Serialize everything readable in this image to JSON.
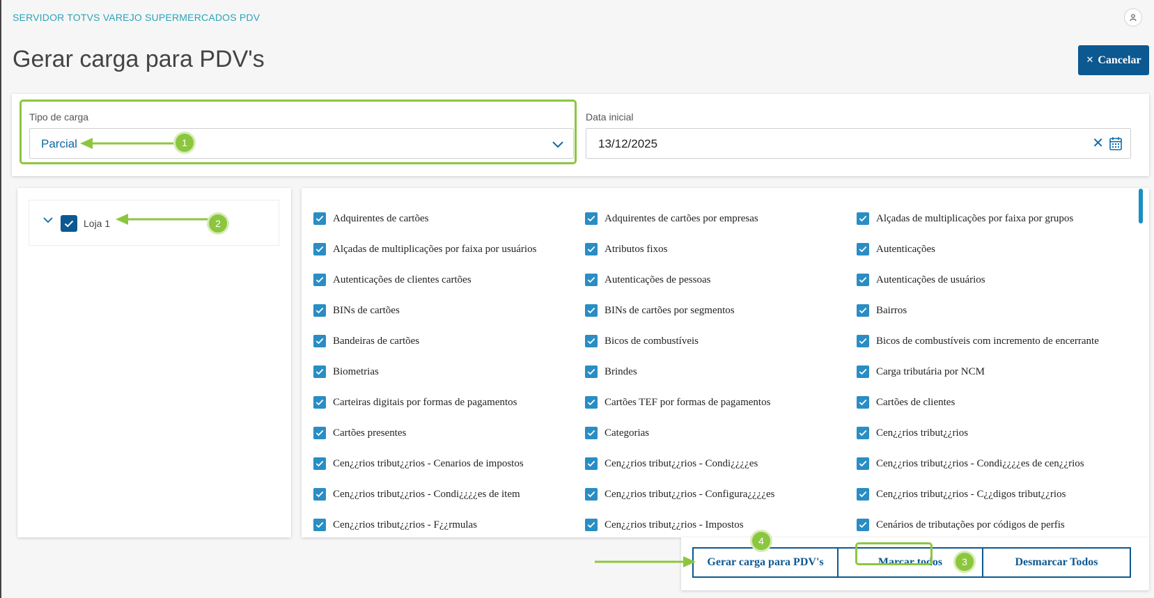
{
  "header": {
    "app_title": "SERVIDOR TOTVS VAREJO SUPERMERCADOS PDV",
    "page_title": "Gerar carga para PDV's",
    "cancel_label": "Cancelar",
    "user_icon": "user-icon"
  },
  "filters": {
    "tipo_label": "Tipo de carga",
    "tipo_value": "Parcial",
    "data_label": "Data inicial",
    "data_value": "13/12/2025"
  },
  "tree": {
    "node_label": "Loja 1",
    "checked": true
  },
  "items": [
    "Adquirentes de cartões",
    "Adquirentes de cartões por empresas",
    "Alçadas de multiplicações por faixa por grupos",
    "Alçadas de multiplicações por faixa por usuários",
    "Atributos fixos",
    "Autenticações",
    "Autenticações de clientes cartões",
    "Autenticações de pessoas",
    "Autenticações de usuários",
    "BINs de cartões",
    "BINs de cartões por segmentos",
    "Bairros",
    "Bandeiras de cartões",
    "Bicos de combustíveis",
    "Bicos de combustíveis com incremento de encerrante",
    "Biometrias",
    "Brindes",
    "Carga tributária por NCM",
    "Carteiras digitais por formas de pagamentos",
    "Cartões TEF por formas de pagamentos",
    "Cartões de clientes",
    "Cartões presentes",
    "Categorias",
    "Cen¿¿rios tribut¿¿rios",
    "Cen¿¿rios tribut¿¿rios - Cenarios de impostos",
    "Cen¿¿rios tribut¿¿rios - Condi¿¿¿¿es",
    "Cen¿¿rios tribut¿¿rios - Condi¿¿¿¿es de cen¿¿rios",
    "Cen¿¿rios tribut¿¿rios - Condi¿¿¿¿es de item",
    "Cen¿¿rios tribut¿¿rios - Configura¿¿¿¿es",
    "Cen¿¿rios tribut¿¿rios - C¿¿digos tribut¿¿rios",
    "Cen¿¿rios tribut¿¿rios - F¿¿rmulas",
    "Cen¿¿rios tribut¿¿rios - Impostos",
    "Cenários de tributações por códigos de perfis"
  ],
  "actions": {
    "gerar_label": "Gerar carga para PDV's",
    "marcar_label": "Marcar todos",
    "desmarcar_label": "Desmarcar Todos"
  },
  "annotations": {
    "badge1": "1",
    "badge2": "2",
    "badge3": "3",
    "badge4": "4",
    "color": "#8cc63f"
  },
  "colors": {
    "primary": "#0c5891",
    "accent": "#2aa3b8",
    "checkbox": "#2a8dc4"
  }
}
